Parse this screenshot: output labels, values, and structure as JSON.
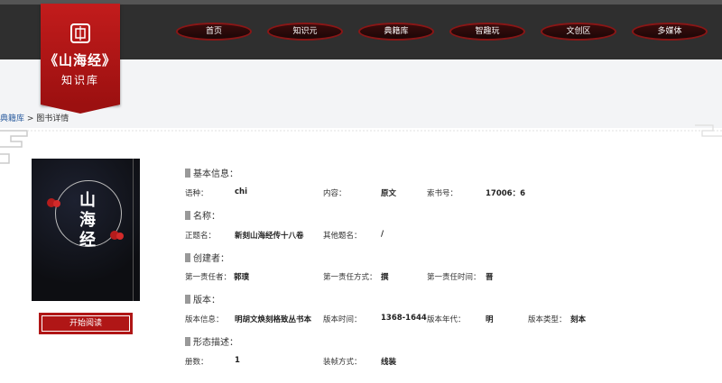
{
  "logo": {
    "title": "《山海经》",
    "subtitle": "知识库",
    "emblem_icon": "seal-emblem-icon"
  },
  "nav": [
    "首页",
    "知识元",
    "典籍库",
    "智趣玩",
    "文创区",
    "多媒体"
  ],
  "breadcrumb": {
    "link": "典籍库",
    "sep": " > ",
    "current": "图书详情"
  },
  "cover": {
    "title_line1": "山",
    "title_line2": "海",
    "title_line3": "经"
  },
  "read_button": "开始阅读",
  "sections": {
    "basic": {
      "heading": "基本信息：",
      "language_label": "语种：",
      "language": "chi",
      "content_label": "内容：",
      "content": "原文",
      "callno_label": "索书号：",
      "callno": "17006：6"
    },
    "name": {
      "heading": "名称：",
      "title_label": "正题名：",
      "title": "新刻山海经传十八卷",
      "other_label": "其他题名：",
      "other": "/"
    },
    "creator": {
      "heading": "创建者：",
      "resp_label": "第一责任者：",
      "resp": "郭璞",
      "mode_label": "第一责任方式：",
      "mode": "撰",
      "time_label": "第一责任时间：",
      "time": "晋"
    },
    "edition": {
      "heading": "版本：",
      "info_label": "版本信息：",
      "info": "明胡文焕刻格致丛书本",
      "time_label": "版本时间：",
      "time": "1368-1644",
      "era_label": "版本年代：",
      "era": "明",
      "type_label": "版本类型：",
      "type": "刻本"
    },
    "form": {
      "heading": "形态描述：",
      "vol_label": "册数：",
      "vol": "1",
      "bind_label": "装帧方式：",
      "bind": "线装"
    }
  }
}
